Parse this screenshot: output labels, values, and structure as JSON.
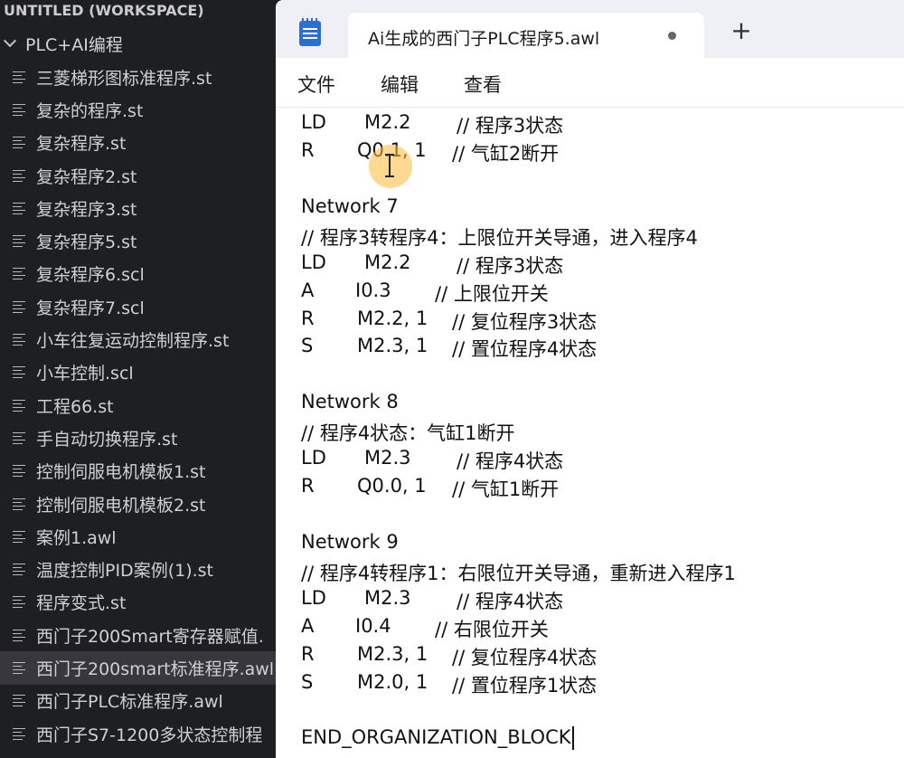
{
  "explorer": {
    "workspace_title": "UNTITLED (WORKSPACE)",
    "folder_name": "PLC+AI编程",
    "files": [
      "三菱梯形图标准程序.st",
      "复杂的程序.st",
      "复杂程序.st",
      "复杂程序2.st",
      "复杂程序3.st",
      "复杂程序5.st",
      "复杂程序6.scl",
      "复杂程序7.scl",
      "小车往复运动控制程序.st",
      "小车控制.scl",
      "工程66.st",
      "手自动切换程序.st",
      "控制伺服电机模板1.st",
      "控制伺服电机模板2.st",
      "案例1.awl",
      "温度控制PID案例(1).st",
      "程序变式.st",
      "西门子200Smart寄存器赋值.",
      "西门子200smart标准程序.awl",
      "西门子PLC标准程序.awl",
      "西门子S7-1200多状态控制程"
    ],
    "selected_index": 18
  },
  "notepad": {
    "tab_title": "Ai生成的西门子PLC程序5.awl",
    "new_tab_symbol": "+",
    "menu": [
      "文件",
      "编辑",
      "查看"
    ]
  },
  "code": [
    {
      "t": "instr",
      "op": "LD",
      "arg": "M2.2",
      "comment": "// 程序3状态"
    },
    {
      "t": "instr",
      "op": "R",
      "arg": "Q0.1, 1",
      "comment": "// 气缸2断开"
    },
    {
      "t": "blank"
    },
    {
      "t": "text",
      "text": "Network 7"
    },
    {
      "t": "text",
      "text": "// 程序3转程序4：上限位开关导通，进入程序4"
    },
    {
      "t": "instr",
      "op": "LD",
      "arg": "M2.2",
      "comment": "// 程序3状态"
    },
    {
      "t": "instr",
      "op": "A",
      "arg": "I0.3",
      "comment": "// 上限位开关"
    },
    {
      "t": "instr",
      "op": "R",
      "arg": "M2.2, 1",
      "comment": "// 复位程序3状态"
    },
    {
      "t": "instr",
      "op": "S",
      "arg": "M2.3, 1",
      "comment": "// 置位程序4状态"
    },
    {
      "t": "blank"
    },
    {
      "t": "text",
      "text": "Network 8"
    },
    {
      "t": "text",
      "text": "// 程序4状态：气缸1断开"
    },
    {
      "t": "instr",
      "op": "LD",
      "arg": "M2.3",
      "comment": "// 程序4状态"
    },
    {
      "t": "instr",
      "op": "R",
      "arg": "Q0.0, 1",
      "comment": "// 气缸1断开"
    },
    {
      "t": "blank"
    },
    {
      "t": "text",
      "text": "Network 9"
    },
    {
      "t": "text",
      "text": "// 程序4转程序1：右限位开关导通，重新进入程序1"
    },
    {
      "t": "instr",
      "op": "LD",
      "arg": "M2.3",
      "comment": "// 程序4状态"
    },
    {
      "t": "instr",
      "op": "A",
      "arg": "I0.4",
      "comment": "// 右限位开关"
    },
    {
      "t": "instr",
      "op": "R",
      "arg": "M2.3, 1",
      "comment": "// 复位程序4状态"
    },
    {
      "t": "instr",
      "op": "S",
      "arg": "M2.0, 1",
      "comment": "// 置位程序1状态"
    },
    {
      "t": "blank"
    },
    {
      "t": "text",
      "text": "END_ORGANIZATION_BLOCK",
      "cursor": true
    }
  ]
}
